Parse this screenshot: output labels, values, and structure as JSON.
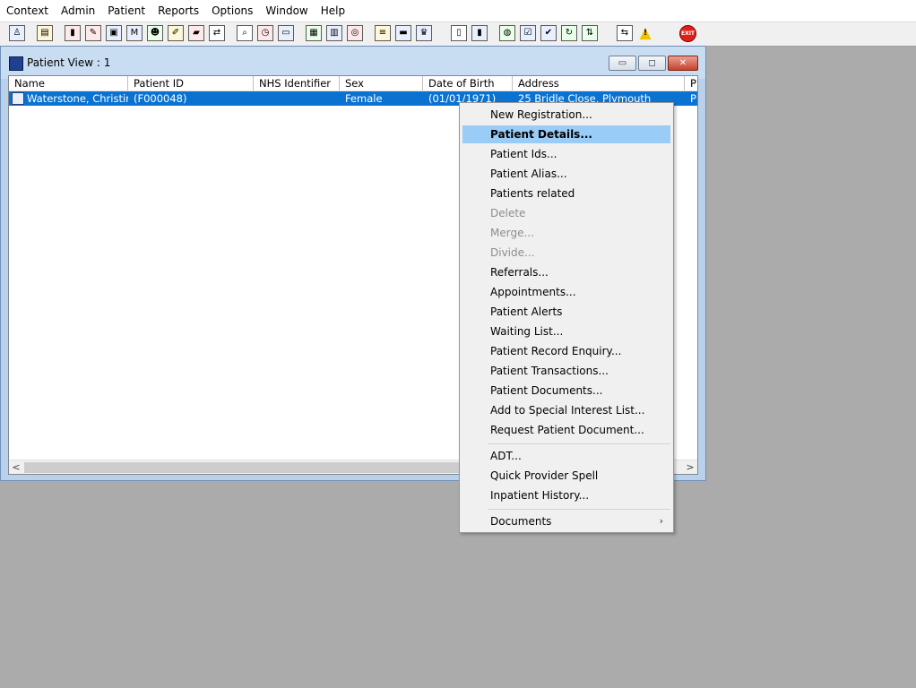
{
  "menubar": {
    "items": [
      "Context",
      "Admin",
      "Patient",
      "Reports",
      "Options",
      "Window",
      "Help"
    ]
  },
  "toolbar": {
    "icons": [
      "person-icon",
      "printer-icon",
      "book-icon",
      "clipboard-icon",
      "card-icon",
      "m-icon",
      "doctor-icon",
      "notes-icon",
      "ambulance-icon",
      "transfer-icon",
      "search-icon",
      "clock-icon",
      "monitor-icon",
      "chart-icon",
      "id-card-icon",
      "globe-icon",
      "note-icon",
      "bed-icon",
      "nurse-icon",
      "document-icon",
      "bar-chart-icon",
      "earth-icon",
      "checklist-icon",
      "check-icon",
      "refresh-icon",
      "swap-icon",
      "warning-icon",
      "exit-icon"
    ],
    "exit_label": "EXIT"
  },
  "window": {
    "title": "Patient View : 1",
    "min_glyph": "▭",
    "max_glyph": "◻",
    "close_glyph": "✕"
  },
  "list": {
    "columns": [
      "Name",
      "Patient ID",
      "NHS Identifier",
      "Sex",
      "Date of Birth",
      "Address",
      "P"
    ],
    "row": {
      "name": "Waterstone, Christine...",
      "patient_id": "(F000048)",
      "nhs": "",
      "sex": "Female",
      "dob": "(01/01/1971)",
      "address": "25 Bridle Close, Plymouth",
      "p": "P"
    },
    "scroll_left": "<",
    "scroll_right": ">"
  },
  "context_menu": {
    "items": [
      {
        "label": "New Registration...",
        "state": "normal"
      },
      {
        "label": "Patient Details...",
        "state": "highlighted"
      },
      {
        "label": "Patient Ids...",
        "state": "normal"
      },
      {
        "label": "Patient Alias...",
        "state": "normal"
      },
      {
        "label": "Patients related",
        "state": "normal"
      },
      {
        "label": "Delete",
        "state": "disabled"
      },
      {
        "label": "Merge...",
        "state": "disabled"
      },
      {
        "label": "Divide...",
        "state": "disabled"
      },
      {
        "label": "Referrals...",
        "state": "normal"
      },
      {
        "label": "Appointments...",
        "state": "normal"
      },
      {
        "label": "Patient Alerts",
        "state": "normal"
      },
      {
        "label": "Waiting List...",
        "state": "normal"
      },
      {
        "label": "Patient Record Enquiry...",
        "state": "normal"
      },
      {
        "label": "Patient Transactions...",
        "state": "normal"
      },
      {
        "label": "Patient Documents...",
        "state": "normal"
      },
      {
        "label": "Add to Special Interest List...",
        "state": "normal"
      },
      {
        "label": "Request Patient Document...",
        "state": "normal"
      },
      {
        "label": "ADT...",
        "state": "normal"
      },
      {
        "label": "Quick Provider Spell",
        "state": "normal"
      },
      {
        "label": "Inpatient History...",
        "state": "normal"
      },
      {
        "label": "Documents",
        "state": "submenu"
      }
    ],
    "submenu_arrow": "›"
  },
  "colors": {
    "desktop": "#ababab",
    "selection": "#0a73d1",
    "menu_highlight": "#99ccf7"
  }
}
